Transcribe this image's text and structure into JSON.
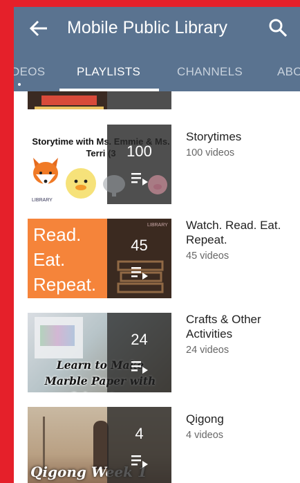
{
  "header": {
    "title": "Mobile Public Library",
    "back_icon": "arrow-back-icon",
    "search_icon": "search-icon"
  },
  "tabs": [
    "DEOS",
    "PLAYLISTS",
    "CHANNELS",
    "ABO"
  ],
  "active_tab": "PLAYLISTS",
  "playlists": [
    {
      "title": "Storytimes",
      "count": "100",
      "subtitle": "100 videos",
      "thumb_text": "Storytime with Ms. Emmie & Ms. Terri (3",
      "thumb_logo": "LIBRARY"
    },
    {
      "title": "Watch. Read. Eat. Repeat.",
      "count": "45",
      "subtitle": "45 videos",
      "thumb_lines": [
        "Read.",
        "Eat.",
        "Repeat."
      ],
      "thumb_tag": "LIBRARY"
    },
    {
      "title": "Crafts & Other Activities",
      "count": "24",
      "subtitle": "24 videos",
      "thumb_text": "Learn to Make Marble Paper with Jaime Lee"
    },
    {
      "title": "Qigong",
      "count": "4",
      "subtitle": "4 videos",
      "thumb_text": "Qigong Week 1"
    }
  ],
  "colors": {
    "header": "#5a7390",
    "accent": "#e5202a",
    "orange": "#f5843a"
  }
}
